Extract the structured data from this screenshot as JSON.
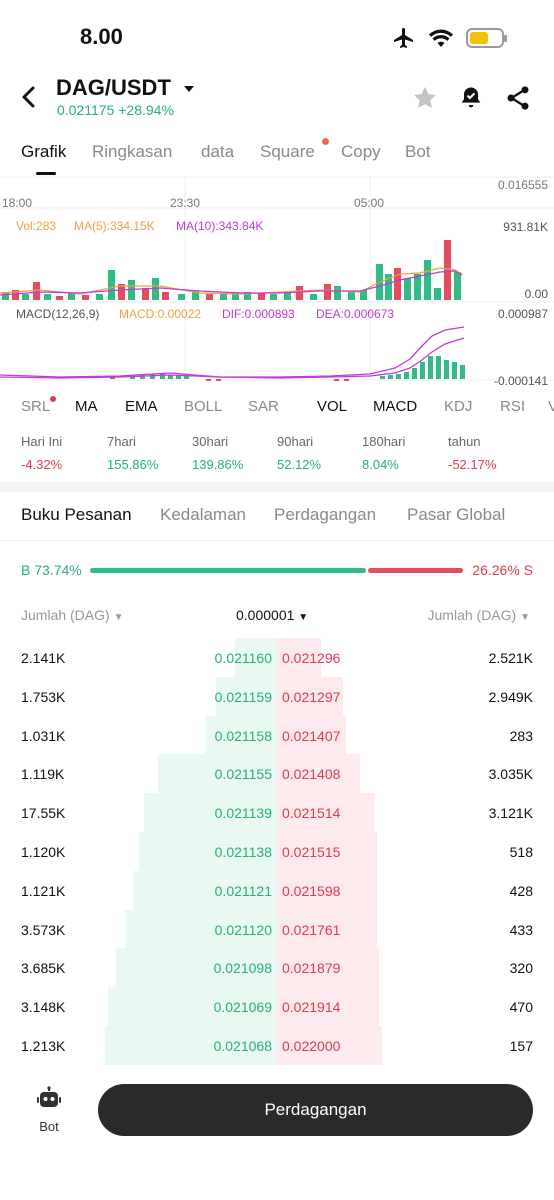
{
  "status_bar": {
    "time": "8.00",
    "icons": [
      "airplane-icon",
      "wifi-icon",
      "battery-icon"
    ]
  },
  "header": {
    "pair": "DAG/USDT",
    "price_change": "0.021175 +28.94%",
    "icons": [
      "star-icon",
      "price-alert-icon",
      "share-icon"
    ]
  },
  "tabs": [
    {
      "label": "Grafik",
      "active": true
    },
    {
      "label": "Ringkasan"
    },
    {
      "label": "data"
    },
    {
      "label": "Square",
      "has_dot": true
    },
    {
      "label": "Copy"
    },
    {
      "label": "Bot"
    }
  ],
  "chart": {
    "price_top": "0.016555",
    "time_labels": [
      "18:00",
      "23:30",
      "05:00"
    ],
    "volume": {
      "vol": "Vol:283",
      "ma5": "MA(5):334.15K",
      "ma10": "MA(10):343.84K",
      "max": "931.81K",
      "min": "0.00"
    },
    "macd": {
      "label": "MACD(12,26,9)",
      "macd": "MACD:0.00022",
      "dif": "DIF:0.000893",
      "dea": "DEA:0.000673",
      "max": "0.000987",
      "min": "-0.000141"
    },
    "colors": {
      "up": "#2ebd85",
      "down": "#ea4a5d",
      "ma5": "#f0a043",
      "ma10": "#c23ad8"
    }
  },
  "indicators": [
    {
      "label": "SRL",
      "dot": true
    },
    {
      "label": "MA",
      "on": true
    },
    {
      "label": "EMA",
      "on": true
    },
    {
      "label": "BOLL"
    },
    {
      "label": "SAR"
    },
    {
      "label": "VOL",
      "on": true
    },
    {
      "label": "MACD",
      "on": true
    },
    {
      "label": "KDJ"
    },
    {
      "label": "RSI"
    },
    {
      "label": "V"
    }
  ],
  "performance": [
    {
      "label": "Hari Ini",
      "value": "-4.32%",
      "dir": "down"
    },
    {
      "label": "7hari",
      "value": "155.86%",
      "dir": "up"
    },
    {
      "label": "30hari",
      "value": "139.86%",
      "dir": "up"
    },
    {
      "label": "90hari",
      "value": "52.12%",
      "dir": "up"
    },
    {
      "label": "180hari",
      "value": "8.04%",
      "dir": "up"
    },
    {
      "label": "tahun",
      "value": "-52.17%",
      "dir": "down"
    }
  ],
  "book_tabs": [
    {
      "label": "Buku Pesanan",
      "active": true
    },
    {
      "label": "Kedalaman"
    },
    {
      "label": "Perdagangan"
    },
    {
      "label": "Pasar Global"
    }
  ],
  "ratio": {
    "buy": "B 73.74%",
    "sell": "26.26% S",
    "buy_fraction": 0.7374
  },
  "book_header": {
    "left": "Jumlah (DAG)",
    "precision": "0.000001",
    "right": "Jumlah (DAG)"
  },
  "order_book": [
    {
      "bid_qty": "2.141K",
      "bid_price": "0.021160",
      "ask_price": "0.021296",
      "ask_qty": "2.521K",
      "bid_depth": 0.15,
      "ask_depth": 0.16
    },
    {
      "bid_qty": "1.753K",
      "bid_price": "0.021159",
      "ask_price": "0.021297",
      "ask_qty": "2.949K",
      "bid_depth": 0.22,
      "ask_depth": 0.24
    },
    {
      "bid_qty": "1.031K",
      "bid_price": "0.021158",
      "ask_price": "0.021407",
      "ask_qty": "283",
      "bid_depth": 0.26,
      "ask_depth": 0.25
    },
    {
      "bid_qty": "1.119K",
      "bid_price": "0.021155",
      "ask_price": "0.021408",
      "ask_qty": "3.035K",
      "bid_depth": 0.43,
      "ask_depth": 0.3
    },
    {
      "bid_qty": "17.55K",
      "bid_price": "0.021139",
      "ask_price": "0.021514",
      "ask_qty": "3.121K",
      "bid_depth": 0.48,
      "ask_depth": 0.35
    },
    {
      "bid_qty": "1.120K",
      "bid_price": "0.021138",
      "ask_price": "0.021515",
      "ask_qty": "518",
      "bid_depth": 0.5,
      "ask_depth": 0.36
    },
    {
      "bid_qty": "1.121K",
      "bid_price": "0.021121",
      "ask_price": "0.021598",
      "ask_qty": "428",
      "bid_depth": 0.52,
      "ask_depth": 0.36
    },
    {
      "bid_qty": "3.573K",
      "bid_price": "0.021120",
      "ask_price": "0.021761",
      "ask_qty": "433",
      "bid_depth": 0.55,
      "ask_depth": 0.36
    },
    {
      "bid_qty": "3.685K",
      "bid_price": "0.021098",
      "ask_price": "0.021879",
      "ask_qty": "320",
      "bid_depth": 0.58,
      "ask_depth": 0.37
    },
    {
      "bid_qty": "3.148K",
      "bid_price": "0.021069",
      "ask_price": "0.021914",
      "ask_qty": "470",
      "bid_depth": 0.61,
      "ask_depth": 0.37
    },
    {
      "bid_qty": "1.213K",
      "bid_price": "0.021068",
      "ask_price": "0.022000",
      "ask_qty": "157",
      "bid_depth": 0.62,
      "ask_depth": 0.38
    }
  ],
  "bottom": {
    "bot_label": "Bot",
    "trade_label": "Perdagangan"
  }
}
